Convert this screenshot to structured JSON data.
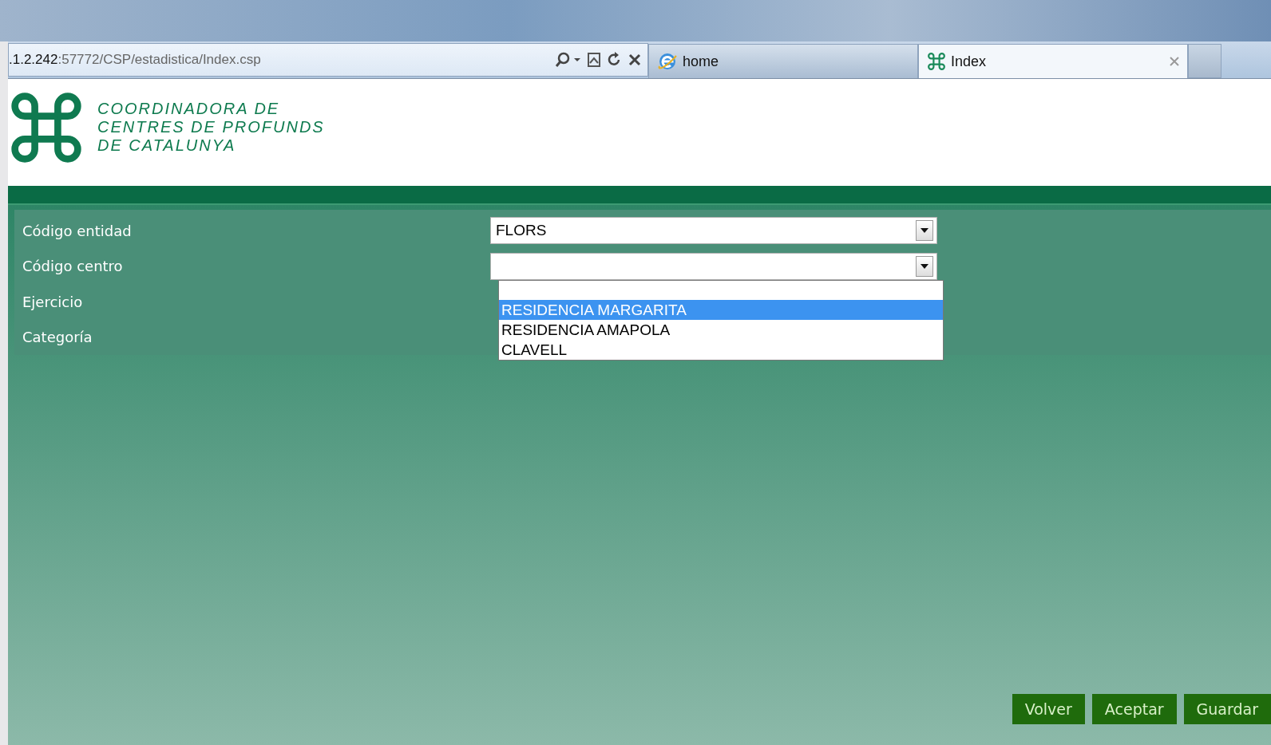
{
  "browser": {
    "address": {
      "host": ".1.2.242",
      "path": ":57772/CSP/estadistica/Index.csp"
    },
    "tabs": [
      {
        "kind": "ie",
        "label": "home",
        "selected": false
      },
      {
        "kind": "site",
        "label": "Index",
        "selected": true
      }
    ]
  },
  "header": {
    "org_lines": [
      "COORDINADORA DE",
      "CENTRES DE PROFUNDS",
      "DE CATALUNYA"
    ]
  },
  "form": {
    "fields": [
      {
        "label": "Código entidad",
        "kind": "select",
        "value": "FLORS"
      },
      {
        "label": "Código centro",
        "kind": "select",
        "open": true,
        "options": [
          {
            "label": "RESIDENCIA MARGARITA",
            "selected": true
          },
          {
            "label": "RESIDENCIA AMAPOLA",
            "selected": false
          },
          {
            "label": "CLAVELL",
            "selected": false
          }
        ]
      },
      {
        "label": "Ejercicio",
        "kind": "none"
      },
      {
        "label": "Categoría",
        "kind": "none"
      }
    ]
  },
  "buttons": [
    "Volver",
    "Aceptar",
    "Guardar"
  ]
}
